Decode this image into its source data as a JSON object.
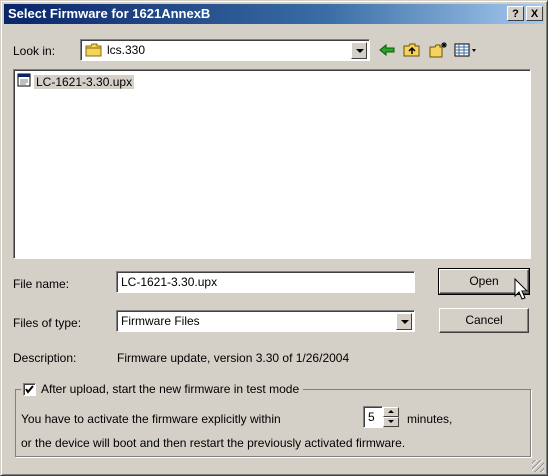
{
  "window": {
    "title": "Select Firmware for 1621AnnexB",
    "help_label": "?",
    "close_label": "X"
  },
  "lookin": {
    "label": "Look in:",
    "folder": "lcs.330"
  },
  "toolbar": {
    "icons": [
      "back-arrow-icon",
      "up-folder-icon",
      "new-folder-icon",
      "view-menu-icon"
    ]
  },
  "file_list": {
    "items": [
      {
        "name": "LC-1621-3.30.upx",
        "icon": "upx-file-icon",
        "selected": true
      }
    ]
  },
  "filename": {
    "label": "File name:",
    "value": "LC-1621-3.30.upx"
  },
  "filetype": {
    "label": "Files of type:",
    "value": "Firmware Files"
  },
  "buttons": {
    "open": "Open",
    "cancel": "Cancel"
  },
  "description": {
    "label": "Description:",
    "value": "Firmware update, version 3.30 of 1/26/2004"
  },
  "test_mode": {
    "checkbox_label": "After upload, start the new firmware in test mode",
    "checked": true,
    "line1_prefix": "You have to activate the firmware explicitly within",
    "minutes_value": "5",
    "line1_suffix": "minutes,",
    "line2": "or the device will boot and then restart the previously activated firmware."
  },
  "colors": {
    "face": "#d4d0c8",
    "title_start": "#0a246a",
    "title_end": "#a6caf0",
    "selection": "#d4d0c8"
  }
}
